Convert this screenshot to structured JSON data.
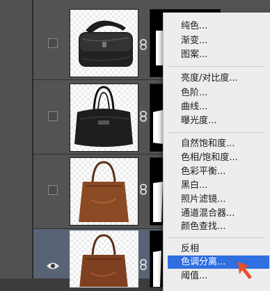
{
  "layers": [
    {
      "visible": false,
      "selected": false,
      "bag": "black-messenger"
    },
    {
      "visible": false,
      "selected": false,
      "bag": "black-duffel"
    },
    {
      "visible": false,
      "selected": false,
      "bag": "brown-tote"
    },
    {
      "visible": true,
      "selected": true,
      "bag": "brown-tote"
    }
  ],
  "adjustment_menu": {
    "groups": [
      [
        "纯色...",
        "渐变...",
        "图案..."
      ],
      [
        "亮度/对比度...",
        "色阶...",
        "曲线...",
        "曝光度..."
      ],
      [
        "自然饱和度...",
        "色相/饱和度...",
        "色彩平衡...",
        "黑白...",
        "照片滤镜...",
        "通道混合器...",
        "颜色查找..."
      ],
      [
        "反相",
        "色调分离...",
        "阈值..."
      ]
    ],
    "highlighted": "色调分离..."
  },
  "colors": {
    "menu_highlight": "#2f6fe0",
    "cursor_arrow": "#e8502a",
    "selected_row": "#596376"
  }
}
